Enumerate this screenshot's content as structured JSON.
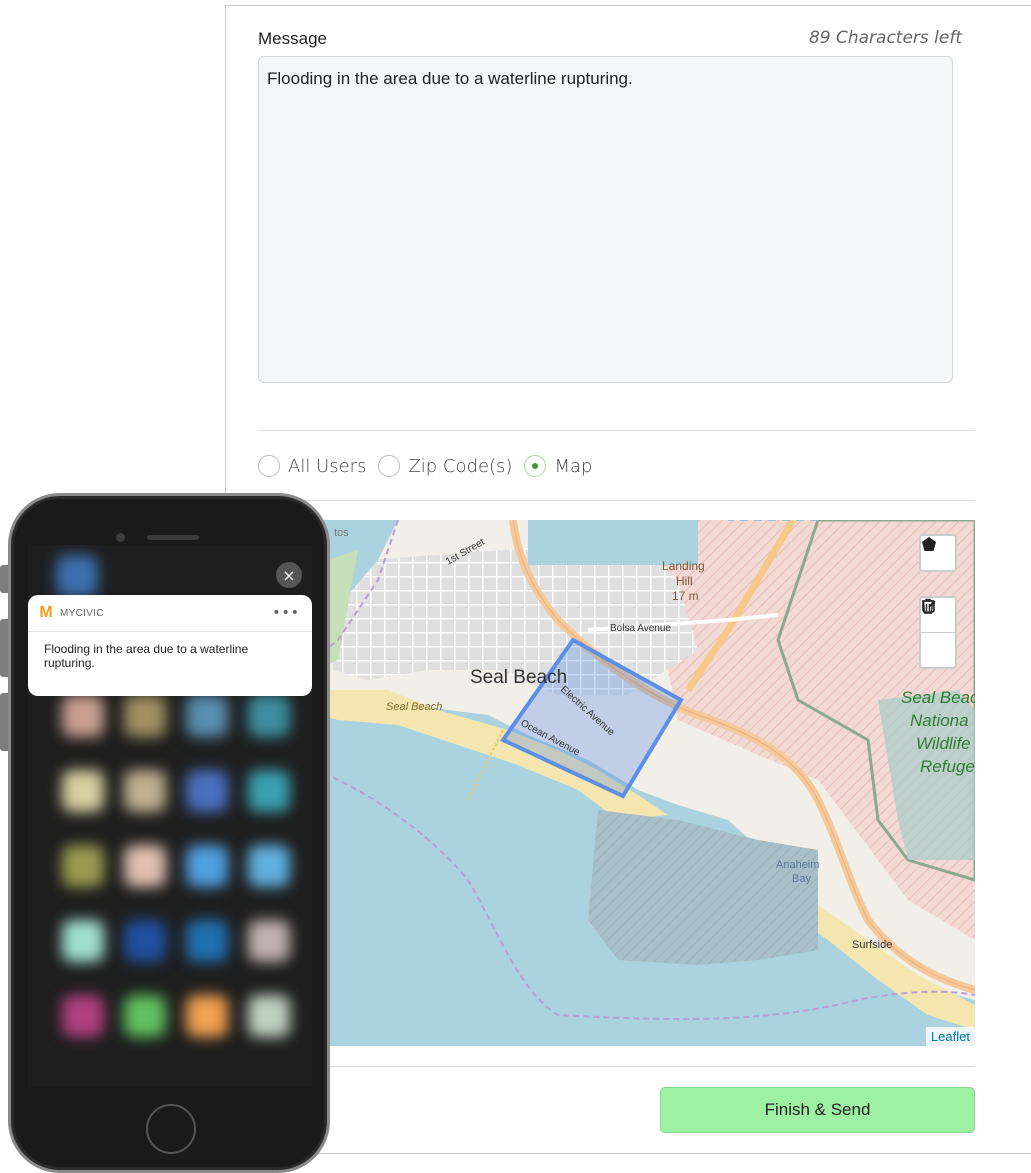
{
  "message": {
    "label": "Message",
    "chars_left": "89 Characters left",
    "value": "Flooding in the area due to a waterline rupturing."
  },
  "audience": {
    "options": [
      {
        "label": "All Users",
        "selected": false
      },
      {
        "label": "Zip Code(s)",
        "selected": false
      },
      {
        "label": "Map",
        "selected": true
      }
    ]
  },
  "map": {
    "labels": {
      "seal_beach_city": "Seal Beach",
      "seal_beach_shore": "Seal Beach",
      "first_street": "1st Street",
      "landing_hill": "Landing",
      "landing_hill_2": "Hill",
      "landing_hill_elev": "17 m",
      "bolsa_avenue": "Bolsa Avenue",
      "electric_avenue": "Electric Avenue",
      "ocean_avenue": "Ocean Avenue",
      "refuge_1": "Seal Beac",
      "refuge_2": "Nationa",
      "refuge_3": "Wildlife",
      "refuge_4": "Refuge",
      "anaheim_1": "Anaheim",
      "anaheim_2": "Bay",
      "surfside": "Surfside",
      "alamitos": "tos"
    },
    "attribution": "Leaflet",
    "tools": {
      "polygon": "polygon-icon",
      "edit": "edit-icon",
      "delete": "trash-icon"
    },
    "colors": {
      "water": "#aad3df",
      "land": "#f2efe9",
      "selection": "#3f7fe3"
    }
  },
  "actions": {
    "finish_label": "Finish & Send"
  },
  "notification": {
    "app_name": "MYCIVIC",
    "more": "•••",
    "body": "Flooding in the area due to a waterline rupturing.",
    "close": "×",
    "brand_color": "#f29a1e"
  }
}
